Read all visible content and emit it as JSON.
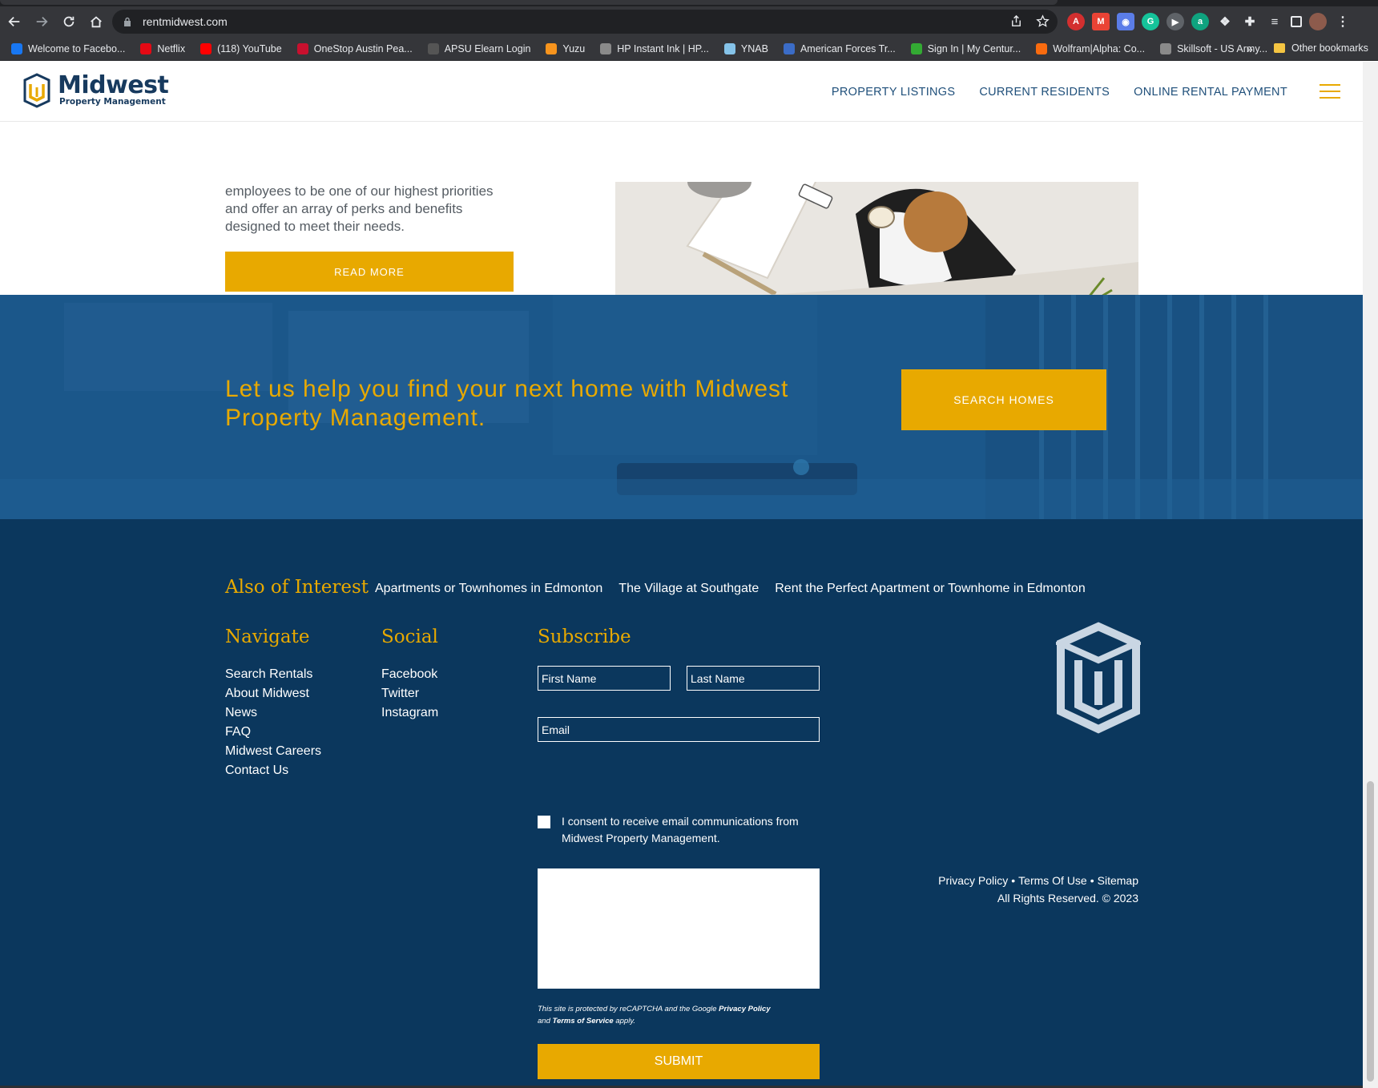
{
  "browser": {
    "url": "rentmidwest.com",
    "bookmarks": [
      {
        "label": "Welcome to Facebo...",
        "icon": "facebook-icon",
        "color": "#1877f2"
      },
      {
        "label": "Netflix",
        "icon": "netflix-icon",
        "color": "#e50914"
      },
      {
        "label": "(118) YouTube",
        "icon": "youtube-icon",
        "color": "#ff0000"
      },
      {
        "label": "OneStop Austin Pea...",
        "icon": "apsu-icon",
        "color": "#c8102e"
      },
      {
        "label": "APSU Elearn Login",
        "icon": "d2l-icon",
        "color": "#555555"
      },
      {
        "label": "Yuzu",
        "icon": "yuzu-icon",
        "color": "#f7941d"
      },
      {
        "label": "HP Instant Ink | HP...",
        "icon": "globe-icon",
        "color": "#8a8a8a"
      },
      {
        "label": "YNAB",
        "icon": "ynab-icon",
        "color": "#85c3e9"
      },
      {
        "label": "American Forces Tr...",
        "icon": "aft-icon",
        "color": "#3b6cc7"
      },
      {
        "label": "Sign In | My Centur...",
        "icon": "century-icon",
        "color": "#33aa33"
      },
      {
        "label": "Wolfram|Alpha: Co...",
        "icon": "wolfram-icon",
        "color": "#f96b0f"
      },
      {
        "label": "Skillsoft - US Army...",
        "icon": "globe-icon",
        "color": "#8a8a8a"
      }
    ],
    "more_label": "»",
    "other_bookmarks": "Other bookmarks"
  },
  "header": {
    "logo_name": "Midwest",
    "logo_sub": "Property Management",
    "nav": [
      "PROPERTY LISTINGS",
      "CURRENT RESIDENTS",
      "ONLINE RENTAL PAYMENT"
    ]
  },
  "careers": {
    "text": "employees to be one of our highest priorities and offer an array of perks and benefits designed to meet their needs.",
    "button": "READ MORE"
  },
  "cta": {
    "text": "Let us help you find your next home with Midwest Property Management.",
    "button": "SEARCH HOMES"
  },
  "footer": {
    "also_heading": "Also of Interest",
    "also_links": [
      "Apartments or Townhomes in Edmonton",
      "The Village at Southgate",
      "Rent the Perfect Apartment or Townhome in Edmonton"
    ],
    "navigate_heading": "Navigate",
    "navigate_links": [
      "Search Rentals",
      "About Midwest",
      "News",
      "FAQ",
      "Midwest Careers",
      "Contact Us"
    ],
    "social_heading": "Social",
    "social_links": [
      "Facebook",
      "Twitter",
      "Instagram"
    ],
    "subscribe_heading": "Subscribe",
    "first_name": "First Name",
    "last_name": "Last Name",
    "email": "Email",
    "consent": "I consent to receive email communications from Midwest Property Management.",
    "recaptcha_pre": "This site is protected by reCAPTCHA and the Google ",
    "recaptcha_privacy": "Privacy Policy",
    "recaptcha_and": "and ",
    "recaptcha_terms": "Terms of Service",
    "recaptcha_post": " apply.",
    "submit": "SUBMIT",
    "legal_privacy": "Privacy Policy",
    "legal_terms": "Terms Of Use",
    "legal_sitemap": "Sitemap",
    "legal_sep": "•",
    "copyright": "All Rights Reserved. © 2023"
  },
  "colors": {
    "accent": "#e8a900",
    "navy": "#0b375d",
    "cta_blue": "#1d5a8a"
  }
}
